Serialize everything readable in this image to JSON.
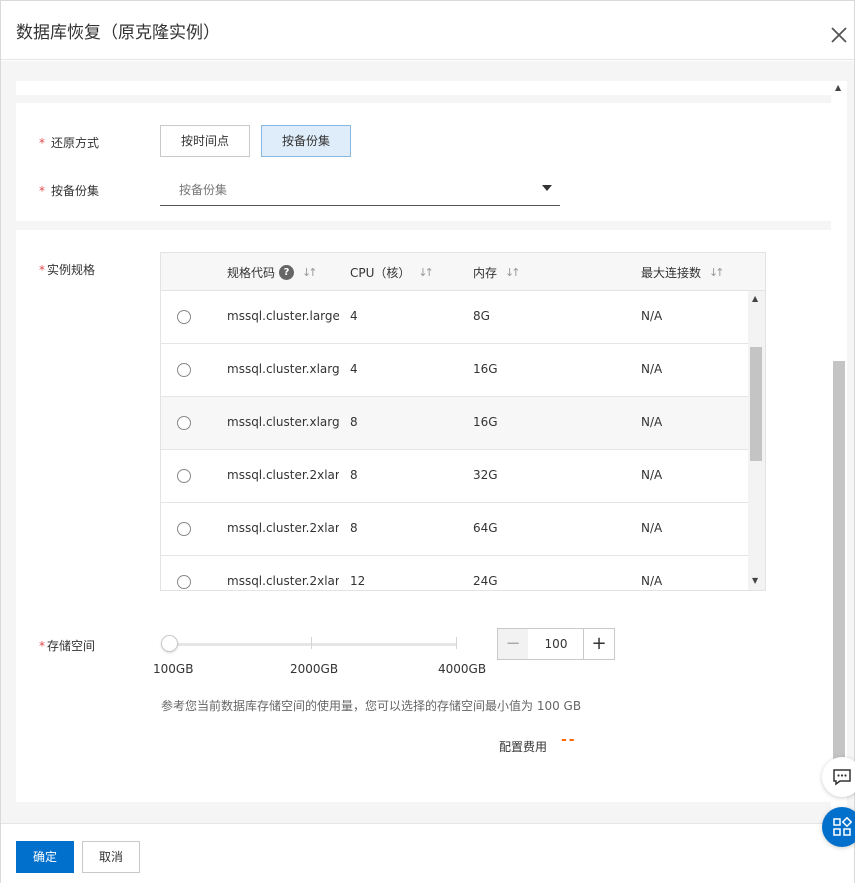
{
  "dialog": {
    "title": "数据库恢复（原克隆实例）"
  },
  "restore": {
    "label": "还原方式",
    "options": [
      "按时间点",
      "按备份集"
    ],
    "selected": "按备份集"
  },
  "backup_set": {
    "label": "按备份集",
    "placeholder": "按备份集"
  },
  "spec": {
    "label": "实例规格",
    "columns": [
      "规格代码",
      "CPU（核）",
      "内存",
      "最大连接数"
    ],
    "rows": [
      {
        "code": "mssql.cluster.large...",
        "cpu": "4",
        "mem": "8G",
        "conn": "N/A"
      },
      {
        "code": "mssql.cluster.xlarg...",
        "cpu": "4",
        "mem": "16G",
        "conn": "N/A"
      },
      {
        "code": "mssql.cluster.xlarg...",
        "cpu": "8",
        "mem": "16G",
        "conn": "N/A"
      },
      {
        "code": "mssql.cluster.2xlar...",
        "cpu": "8",
        "mem": "32G",
        "conn": "N/A"
      },
      {
        "code": "mssql.cluster.2xlar...",
        "cpu": "8",
        "mem": "64G",
        "conn": "N/A"
      },
      {
        "code": "mssql.cluster.2xlar...",
        "cpu": "12",
        "mem": "24G",
        "conn": "N/A"
      }
    ]
  },
  "storage": {
    "label": "存储空间",
    "min_label": "100GB",
    "mid_label": "2000GB",
    "max_label": "4000GB",
    "value": "100",
    "hint": "参考您当前数据库存储空间的使用量，您可以选择的存储空间最小值为 100 GB"
  },
  "fee": {
    "label": "配置费用",
    "value": "--"
  },
  "footer": {
    "ok": "确定",
    "cancel": "取消"
  },
  "colors": {
    "primary": "#0070cc",
    "required": "#e14b4b",
    "fee": "#ff6a00",
    "active_bg": "#deedf9"
  }
}
